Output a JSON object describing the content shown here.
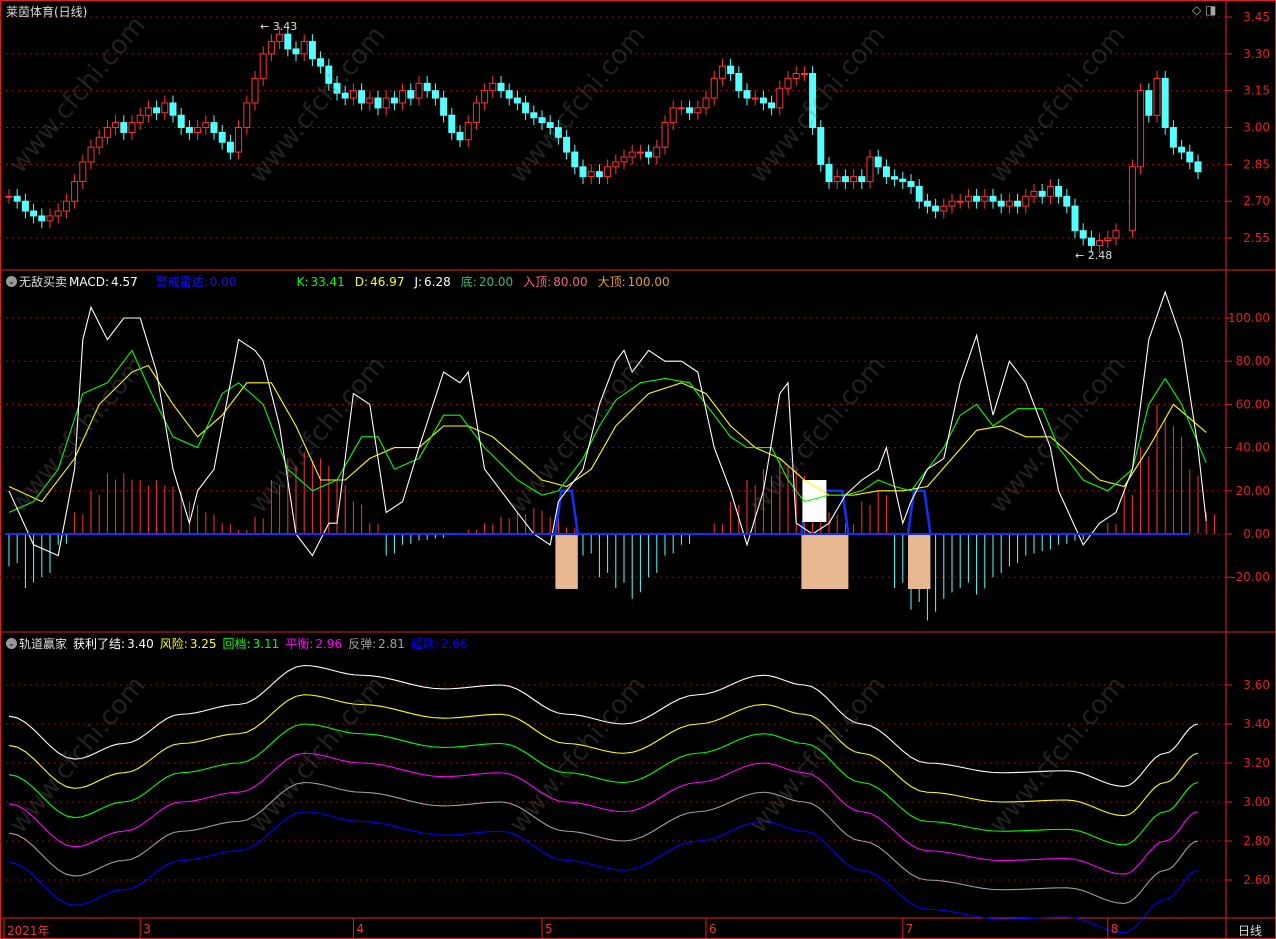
{
  "title": "莱茵体育(日线)",
  "period_label": "日线",
  "watermark": "www.cfchi.com",
  "colors": {
    "up": "#ff3232",
    "down": "#54ffff",
    "grid": "#aa0000",
    "axis": "#e02020"
  },
  "price_panel": {
    "yticks": [
      "3.45",
      "3.30",
      "3.15",
      "3.00",
      "2.85",
      "2.70",
      "2.55"
    ],
    "ytick_values": [
      3.45,
      3.3,
      3.15,
      3.0,
      2.85,
      2.7,
      2.55
    ],
    "high_label": "3.43",
    "low_label": "2.48",
    "closes": [
      2.72,
      2.7,
      2.66,
      2.64,
      2.62,
      2.64,
      2.66,
      2.7,
      2.78,
      2.86,
      2.92,
      2.96,
      3.0,
      3.02,
      2.98,
      3.02,
      3.05,
      3.08,
      3.06,
      3.1,
      3.05,
      3.0,
      2.98,
      3.0,
      3.02,
      2.98,
      2.94,
      2.9,
      3.0,
      3.1,
      3.2,
      3.3,
      3.35,
      3.38,
      3.32,
      3.3,
      3.35,
      3.28,
      3.25,
      3.18,
      3.14,
      3.12,
      3.15,
      3.1,
      3.12,
      3.08,
      3.12,
      3.1,
      3.15,
      3.12,
      3.18,
      3.15,
      3.12,
      3.05,
      2.98,
      2.95,
      3.02,
      3.1,
      3.15,
      3.18,
      3.15,
      3.12,
      3.1,
      3.06,
      3.04,
      3.02,
      3.0,
      2.96,
      2.9,
      2.84,
      2.8,
      2.82,
      2.8,
      2.84,
      2.86,
      2.88,
      2.9,
      2.9,
      2.88,
      2.92,
      3.02,
      3.08,
      3.08,
      3.06,
      3.08,
      3.12,
      3.2,
      3.25,
      3.22,
      3.15,
      3.12,
      3.12,
      3.1,
      3.08,
      3.16,
      3.2,
      3.22,
      3.22,
      3.0,
      2.85,
      2.78,
      2.8,
      2.78,
      2.8,
      2.78,
      2.88,
      2.84,
      2.8,
      2.79,
      2.78,
      2.76,
      2.7,
      2.68,
      2.66,
      2.68,
      2.7,
      2.7,
      2.72,
      2.7,
      2.72,
      2.7,
      2.68,
      2.7,
      2.68,
      2.72,
      2.74,
      2.72,
      2.76,
      2.72,
      2.68,
      2.58,
      2.55,
      2.52,
      2.54,
      2.55,
      2.58,
      null,
      2.84,
      3.15,
      3.05,
      3.2,
      3.0,
      2.92,
      2.9,
      2.86,
      2.82
    ]
  },
  "macd_panel": {
    "name": "无敌买卖",
    "macd_label": "MACD:",
    "macd_value": "4.57",
    "alert_label": "警戒雷达:",
    "alert_value": "0.00",
    "k_label": "K:",
    "k_value": "33.41",
    "d_label": "D:",
    "d_value": "46.97",
    "j_label": "J:",
    "j_value": "6.28",
    "bottom_label": "底:",
    "bottom_value": "20.00",
    "entry_label": "入顶:",
    "entry_value": "80.00",
    "top_label": "大顶:",
    "top_value": "100.00",
    "yticks": [
      "100.00",
      "80.00",
      "60.00",
      "40.00",
      "20.00",
      "0.00",
      "-20.00"
    ],
    "ytick_values": [
      100,
      80,
      60,
      40,
      20,
      0,
      -20
    ],
    "J": [
      [
        0,
        20
      ],
      [
        3,
        -5
      ],
      [
        6,
        -10
      ],
      [
        8,
        30
      ],
      [
        9,
        90
      ],
      [
        10,
        105
      ],
      [
        12,
        90
      ],
      [
        14,
        100
      ],
      [
        16,
        100
      ],
      [
        18,
        75
      ],
      [
        20,
        30
      ],
      [
        22,
        5
      ],
      [
        23,
        20
      ],
      [
        25,
        30
      ],
      [
        28,
        90
      ],
      [
        30,
        85
      ],
      [
        31,
        80
      ],
      [
        33,
        50
      ],
      [
        35,
        0
      ],
      [
        37,
        -10
      ],
      [
        39,
        5
      ],
      [
        40,
        5
      ],
      [
        42,
        65
      ],
      [
        44,
        60
      ],
      [
        46,
        10
      ],
      [
        48,
        15
      ],
      [
        50,
        40
      ],
      [
        53,
        75
      ],
      [
        55,
        70
      ],
      [
        56,
        75
      ],
      [
        58,
        30
      ],
      [
        62,
        10
      ],
      [
        64,
        0
      ],
      [
        66,
        -5
      ],
      [
        67,
        15
      ],
      [
        70,
        30
      ],
      [
        72,
        60
      ],
      [
        74,
        80
      ],
      [
        75,
        85
      ],
      [
        76,
        75
      ],
      [
        78,
        85
      ],
      [
        80,
        80
      ],
      [
        82,
        80
      ],
      [
        84,
        75
      ],
      [
        86,
        40
      ],
      [
        88,
        20
      ],
      [
        90,
        -5
      ],
      [
        92,
        20
      ],
      [
        94,
        65
      ],
      [
        95,
        70
      ],
      [
        96,
        5
      ],
      [
        98,
        0
      ],
      [
        100,
        5
      ],
      [
        102,
        18
      ],
      [
        104,
        25
      ],
      [
        106,
        30
      ],
      [
        107,
        40
      ],
      [
        108,
        22
      ],
      [
        109,
        5
      ],
      [
        110,
        15
      ],
      [
        112,
        30
      ],
      [
        114,
        35
      ],
      [
        116,
        70
      ],
      [
        118,
        92
      ],
      [
        120,
        55
      ],
      [
        122,
        80
      ],
      [
        124,
        70
      ],
      [
        127,
        40
      ],
      [
        128,
        20
      ],
      [
        131,
        -5
      ],
      [
        133,
        5
      ],
      [
        135,
        10
      ],
      [
        137,
        30
      ],
      [
        139,
        90
      ],
      [
        141,
        112
      ],
      [
        143,
        90
      ],
      [
        145,
        40
      ],
      [
        146,
        6
      ]
    ],
    "K": [
      [
        0,
        10
      ],
      [
        3,
        15
      ],
      [
        6,
        30
      ],
      [
        9,
        65
      ],
      [
        12,
        70
      ],
      [
        15,
        85
      ],
      [
        18,
        60
      ],
      [
        20,
        45
      ],
      [
        23,
        40
      ],
      [
        26,
        65
      ],
      [
        28,
        70
      ],
      [
        31,
        60
      ],
      [
        34,
        30
      ],
      [
        37,
        20
      ],
      [
        40,
        25
      ],
      [
        43,
        45
      ],
      [
        45,
        45
      ],
      [
        47,
        30
      ],
      [
        50,
        35
      ],
      [
        53,
        55
      ],
      [
        55,
        55
      ],
      [
        58,
        40
      ],
      [
        62,
        25
      ],
      [
        65,
        18
      ],
      [
        67,
        20
      ],
      [
        70,
        35
      ],
      [
        72,
        50
      ],
      [
        74,
        62
      ],
      [
        77,
        70
      ],
      [
        80,
        72
      ],
      [
        83,
        70
      ],
      [
        85,
        60
      ],
      [
        88,
        45
      ],
      [
        90,
        40
      ],
      [
        93,
        40
      ],
      [
        95,
        25
      ],
      [
        97,
        15
      ],
      [
        100,
        18
      ],
      [
        102,
        18
      ],
      [
        104,
        20
      ],
      [
        106,
        25
      ],
      [
        108,
        22
      ],
      [
        110,
        20
      ],
      [
        112,
        30
      ],
      [
        114,
        40
      ],
      [
        116,
        55
      ],
      [
        118,
        60
      ],
      [
        120,
        50
      ],
      [
        123,
        58
      ],
      [
        126,
        58
      ],
      [
        128,
        40
      ],
      [
        131,
        25
      ],
      [
        134,
        20
      ],
      [
        137,
        30
      ],
      [
        139,
        60
      ],
      [
        141,
        72
      ],
      [
        143,
        60
      ],
      [
        146,
        33
      ]
    ],
    "D": [
      [
        0,
        22
      ],
      [
        4,
        15
      ],
      [
        8,
        35
      ],
      [
        11,
        60
      ],
      [
        15,
        75
      ],
      [
        17,
        78
      ],
      [
        20,
        60
      ],
      [
        23,
        45
      ],
      [
        26,
        55
      ],
      [
        29,
        70
      ],
      [
        32,
        70
      ],
      [
        35,
        50
      ],
      [
        38,
        25
      ],
      [
        41,
        25
      ],
      [
        44,
        35
      ],
      [
        47,
        40
      ],
      [
        50,
        40
      ],
      [
        53,
        50
      ],
      [
        56,
        50
      ],
      [
        59,
        45
      ],
      [
        62,
        35
      ],
      [
        65,
        25
      ],
      [
        68,
        22
      ],
      [
        71,
        30
      ],
      [
        74,
        50
      ],
      [
        78,
        65
      ],
      [
        82,
        70
      ],
      [
        85,
        65
      ],
      [
        88,
        50
      ],
      [
        91,
        40
      ],
      [
        94,
        35
      ],
      [
        97,
        25
      ],
      [
        100,
        18
      ],
      [
        103,
        18
      ],
      [
        106,
        20
      ],
      [
        109,
        20
      ],
      [
        112,
        22
      ],
      [
        115,
        35
      ],
      [
        118,
        48
      ],
      [
        121,
        50
      ],
      [
        124,
        45
      ],
      [
        127,
        45
      ],
      [
        130,
        35
      ],
      [
        133,
        25
      ],
      [
        136,
        22
      ],
      [
        139,
        40
      ],
      [
        142,
        60
      ],
      [
        146,
        47
      ]
    ],
    "hist_every2": [
      -15,
      -25,
      -20,
      -5,
      10,
      20,
      28,
      28,
      25,
      25,
      22,
      15,
      10,
      5,
      2,
      8,
      25,
      35,
      38,
      35,
      25,
      15,
      5,
      -10,
      -5,
      -3,
      -2,
      0,
      2,
      5,
      8,
      10,
      12,
      8,
      3,
      -10,
      -20,
      -25,
      -30,
      -20,
      -10,
      -5,
      0,
      5,
      15,
      25,
      30,
      35,
      30,
      20,
      10,
      5,
      15,
      20,
      -25,
      -35,
      -40,
      -30,
      -25,
      -28,
      -20,
      -15,
      -10,
      -8,
      -5,
      -3,
      0,
      5,
      20,
      40,
      60,
      50,
      30,
      10
    ],
    "signals": [
      [
        67,
        69
      ],
      [
        97,
        102
      ],
      [
        110,
        112
      ]
    ]
  },
  "track_panel": {
    "name": "轨道赢家",
    "labels": [
      {
        "label": "获利了结:",
        "value": "3.40",
        "color": "#ffffff"
      },
      {
        "label": "风险:",
        "value": "3.25",
        "color": "#ffff00"
      },
      {
        "label": "回档:",
        "value": "3.11",
        "color": "#00ff00"
      },
      {
        "label": "平衡:",
        "value": "2.96",
        "color": "#ff00ff"
      },
      {
        "label": "反弹:",
        "value": "2.81",
        "color": "#a0a0a0"
      },
      {
        "label": "超跌:",
        "value": "2.66",
        "color": "#0000ff"
      }
    ],
    "yticks": [
      "3.60",
      "3.40",
      "3.20",
      "3.00",
      "2.80",
      "2.60"
    ],
    "ytick_values": [
      3.6,
      3.4,
      3.2,
      3.0,
      2.8,
      2.6
    ],
    "base": [
      [
        0,
        3.44
      ],
      [
        8,
        3.22
      ],
      [
        14,
        3.3
      ],
      [
        21,
        3.45
      ],
      [
        28,
        3.5
      ],
      [
        36,
        3.7
      ],
      [
        43,
        3.65
      ],
      [
        53,
        3.58
      ],
      [
        60,
        3.6
      ],
      [
        68,
        3.45
      ],
      [
        75,
        3.4
      ],
      [
        84,
        3.55
      ],
      [
        92,
        3.65
      ],
      [
        97,
        3.6
      ],
      [
        104,
        3.4
      ],
      [
        112,
        3.2
      ],
      [
        121,
        3.15
      ],
      [
        129,
        3.16
      ],
      [
        136,
        3.08
      ],
      [
        141,
        3.25
      ],
      [
        145,
        3.4
      ]
    ],
    "band_step": 0.15
  },
  "x_axis": {
    "labels": [
      {
        "i": 0,
        "t": "2021年"
      },
      {
        "i": 16,
        "t": "3"
      },
      {
        "i": 42,
        "t": "4"
      },
      {
        "i": 65,
        "t": "5"
      },
      {
        "i": 85,
        "t": "6"
      },
      {
        "i": 109,
        "t": "7"
      },
      {
        "i": 134,
        "t": "8"
      }
    ]
  }
}
